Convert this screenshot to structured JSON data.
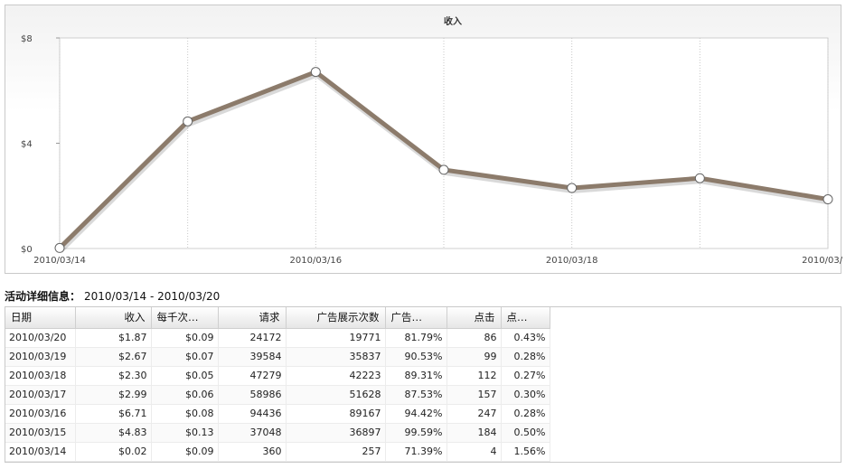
{
  "chart_data": {
    "type": "line",
    "title": "收入",
    "x": [
      "2010/03/14",
      "2010/03/15",
      "2010/03/16",
      "2010/03/17",
      "2010/03/18",
      "2010/03/19",
      "2010/03/20"
    ],
    "values": [
      0.02,
      4.83,
      6.71,
      2.99,
      2.3,
      2.67,
      1.87
    ],
    "x_tick_labels": [
      "2010/03/14",
      "2010/03/16",
      "2010/03/18",
      "2010/03/20"
    ],
    "y_ticks": [
      {
        "value": 0,
        "label": "$0"
      },
      {
        "value": 4,
        "label": "$4"
      },
      {
        "value": 8,
        "label": "$8"
      }
    ],
    "ylim": [
      0,
      8
    ],
    "grid": true,
    "line_color": "#8c7b6b",
    "marker_color": "#ffffff"
  },
  "details": {
    "title": "活动详细信息：",
    "range": "2010/03/14 - 2010/03/20",
    "columns": [
      "日期",
      "收入",
      "每千次…",
      "请求",
      "广告展示次数",
      "广告…",
      "点击",
      "点…"
    ],
    "rows": [
      [
        "2010/03/20",
        "$1.87",
        "$0.09",
        "24172",
        "19771",
        "81.79%",
        "86",
        "0.43%"
      ],
      [
        "2010/03/19",
        "$2.67",
        "$0.07",
        "39584",
        "35837",
        "90.53%",
        "99",
        "0.28%"
      ],
      [
        "2010/03/18",
        "$2.30",
        "$0.05",
        "47279",
        "42223",
        "89.31%",
        "112",
        "0.27%"
      ],
      [
        "2010/03/17",
        "$2.99",
        "$0.06",
        "58986",
        "51628",
        "87.53%",
        "157",
        "0.30%"
      ],
      [
        "2010/03/16",
        "$6.71",
        "$0.08",
        "94436",
        "89167",
        "94.42%",
        "247",
        "0.28%"
      ],
      [
        "2010/03/15",
        "$4.83",
        "$0.13",
        "37048",
        "36897",
        "99.59%",
        "184",
        "0.50%"
      ],
      [
        "2010/03/14",
        "$0.02",
        "$0.09",
        "360",
        "257",
        "71.39%",
        "4",
        "1.56%"
      ]
    ]
  }
}
